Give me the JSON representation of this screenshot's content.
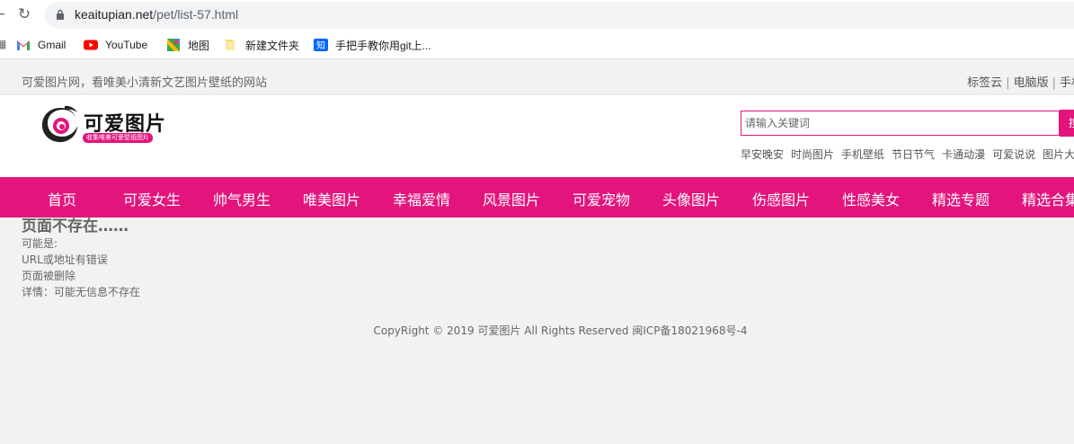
{
  "browser": {
    "url_host": "keaitupian.net",
    "url_path": "/pet/list-57.html",
    "bookmarks": [
      {
        "label": "Gmail",
        "icon": "gmail-icon"
      },
      {
        "label": "YouTube",
        "icon": "youtube-icon"
      },
      {
        "label": "地图",
        "icon": "maps-icon"
      },
      {
        "label": "新建文件夹",
        "icon": "folder-icon"
      },
      {
        "label": "手把手教你用git上...",
        "icon": "zhihu-icon"
      }
    ]
  },
  "site": {
    "tagline": "可爱图片网，看唯美小清新文艺图片壁纸的网站",
    "toplinks": [
      "标签云",
      "电脑版",
      "手机"
    ],
    "logo_title": "可爱图片",
    "logo_sub": "收集唯美可爱壁纸图片",
    "search_placeholder": "请输入关键词",
    "search_button": "搜",
    "hotwords": [
      "早安晚安",
      "时尚图片",
      "手机壁纸",
      "节日节气",
      "卡通动漫",
      "可爱说说",
      "图片大全"
    ],
    "nav": [
      "首页",
      "可爱女生",
      "帅气男生",
      "唯美图片",
      "幸福爱情",
      "风景图片",
      "可爱宠物",
      "头像图片",
      "伤感图片",
      "性感美女",
      "精选专题",
      "精选合集"
    ],
    "error": {
      "title": "页面不存在……",
      "lines": [
        "可能是:",
        "URL或地址有错误",
        "页面被删除",
        "详情：可能无信息不存在"
      ]
    },
    "footer": "CopyRight © 2019 可爱图片 All Rights Reserved 闽ICP备18021968号-4"
  },
  "colors": {
    "accent": "#e4147d"
  }
}
